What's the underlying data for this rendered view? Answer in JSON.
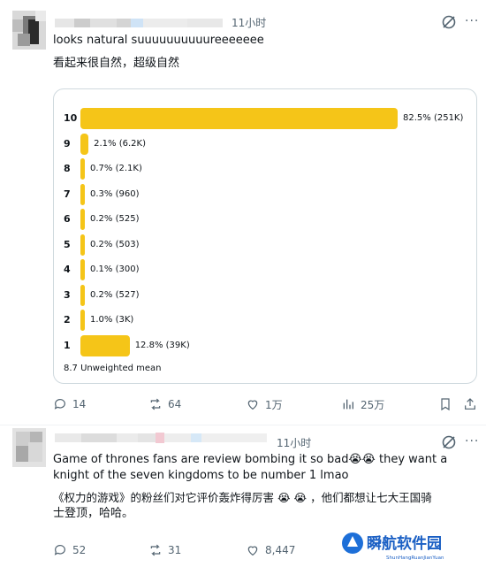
{
  "tweet1": {
    "time": "11小时",
    "text_en": "looks natural suuuuuuuuuureeeeeee",
    "text_zh": "看起来很自然，超级自然",
    "poll": {
      "options": [
        {
          "label": "10",
          "percent_text": "82.5% (251K)",
          "percent": 82.5
        },
        {
          "label": "9",
          "percent_text": "2.1% (6.2K)",
          "percent": 2.1
        },
        {
          "label": "8",
          "percent_text": "0.7% (2.1K)",
          "percent": 0.7
        },
        {
          "label": "7",
          "percent_text": "0.3% (960)",
          "percent": 0.3
        },
        {
          "label": "6",
          "percent_text": "0.2% (525)",
          "percent": 0.2
        },
        {
          "label": "5",
          "percent_text": "0.2% (503)",
          "percent": 0.2
        },
        {
          "label": "4",
          "percent_text": "0.1% (300)",
          "percent": 0.1
        },
        {
          "label": "3",
          "percent_text": "0.2% (527)",
          "percent": 0.2
        },
        {
          "label": "2",
          "percent_text": "1.0% (3K)",
          "percent": 1.0
        },
        {
          "label": "1",
          "percent_text": "12.8% (39K)",
          "percent": 12.8
        }
      ],
      "footer": "8.7 Unweighted mean"
    },
    "actions": {
      "replies": "14",
      "reposts": "64",
      "likes": "1万",
      "views": "25万"
    }
  },
  "tweet2": {
    "time": "11小时",
    "text_en_line1": "Game of thrones fans are review bombing it so bad😭😭 they want a",
    "text_en_line2": "knight of the seven kingdoms to be number 1 lmao",
    "text_zh_line1": "《权力的游戏》的粉丝们对它评价轰炸得厉害 😭 😭 ，他们都想让七大王国骑",
    "text_zh_line2": "士登顶，哈哈。",
    "actions": {
      "replies": "52",
      "reposts": "31",
      "likes": "8,447"
    }
  },
  "watermark": {
    "title": "瞬航软件园",
    "subtitle": "ShunHangRuanJianYuan"
  },
  "colors": {
    "bar": "#f5c518",
    "muted": "#536471",
    "border": "#cfd9de"
  }
}
